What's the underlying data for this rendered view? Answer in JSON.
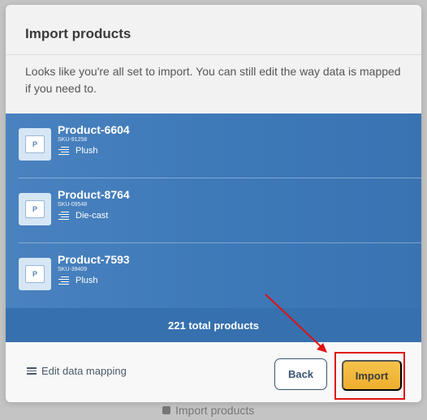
{
  "background": {
    "behind_label": "Import products"
  },
  "modal": {
    "title": "Import products",
    "description": "Looks like you're all set to import. You can still edit the way data is mapped if you need to.",
    "products": [
      {
        "name": "Product-6604",
        "sku": "SKU-91258",
        "category": "Plush",
        "thumb_letter": "P"
      },
      {
        "name": "Product-8764",
        "sku": "SKU-09548",
        "category": "Die-cast",
        "thumb_letter": "P"
      },
      {
        "name": "Product-7593",
        "sku": "SKU-39409",
        "category": "Plush",
        "thumb_letter": "P"
      }
    ],
    "total_text": "221 total products",
    "footer": {
      "edit_mapping_label": "Edit data mapping",
      "back_label": "Back",
      "import_label": "Import"
    }
  },
  "colors": {
    "panel_blue": "#3e79b8",
    "import_yellow": "#f0b43a",
    "annotation_red": "#e01010"
  }
}
